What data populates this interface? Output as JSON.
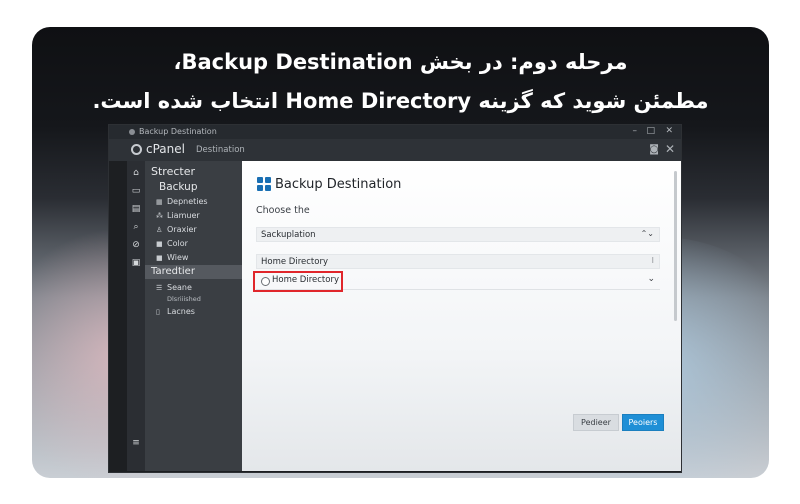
{
  "headline": {
    "line1": "مرحله دوم: در بخش Backup Destination،",
    "line2": "مطمئن شوید که گزینه Home Directory انتخاب شده است."
  },
  "window": {
    "title": "Backup Destination",
    "controls": [
      "–",
      "□",
      "✕"
    ]
  },
  "topbar": {
    "brand": "cPanel",
    "section": "Destination"
  },
  "icon_rail": [
    "home-icon",
    "folder-icon",
    "database-icon",
    "search-icon",
    "link-icon",
    "lock-icon",
    "menu-icon"
  ],
  "sidebar": {
    "heading1": "Strecter",
    "heading_backup": "Backup",
    "items_top": [
      {
        "icon": "grid-icon",
        "label": "Depneties"
      },
      {
        "icon": "users-icon",
        "label": "Liamuer"
      },
      {
        "icon": "user-icon",
        "label": "Oraxier"
      },
      {
        "icon": "folder-icon",
        "label": "Color"
      },
      {
        "icon": "folder-icon",
        "label": "Wiew"
      }
    ],
    "heading2": "Taredtier",
    "items_bottom": [
      {
        "icon": "stack-icon",
        "label": "Seane"
      },
      {
        "icon": "",
        "label": "Dlsriiished"
      },
      {
        "icon": "doc-icon",
        "label": "Lacnes"
      }
    ]
  },
  "panel": {
    "title": "Backup Destination",
    "subtitle": "Choose the",
    "field1": "Sackuplation",
    "field2": "Home Directory",
    "radio_label": "Home Directory",
    "button_secondary": "Pedieer",
    "button_primary": "Peoiers"
  },
  "colors": {
    "highlight": "#e0262b",
    "primary_button": "#1f8fd6",
    "sidebar_bg": "#3a3e43"
  }
}
